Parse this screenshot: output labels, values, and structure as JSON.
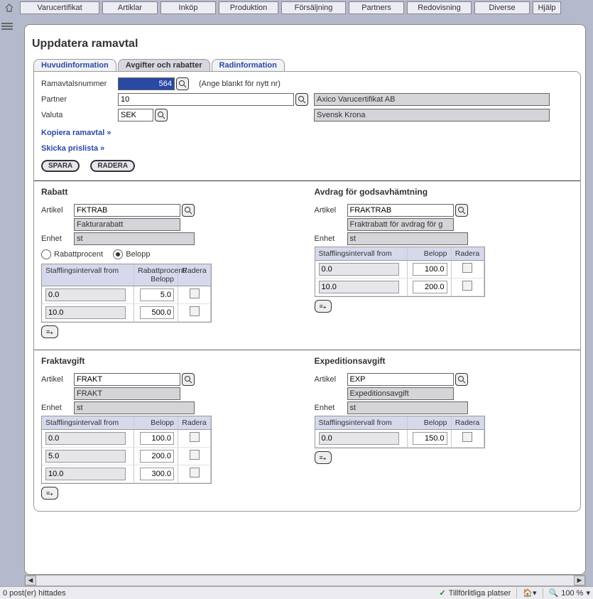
{
  "menu": [
    "Varucertifikat",
    "Artiklar",
    "Inköp",
    "Produktion",
    "Försäljning",
    "Partners",
    "Redovisning",
    "Diverse",
    "Hjälp"
  ],
  "page_title": "Uppdatera ramavtal",
  "tabs": [
    "Huvudinformation",
    "Avgifter och rabatter",
    "Radinformation"
  ],
  "active_tab": 1,
  "form": {
    "ramavtalsnummer_label": "Ramavtalsnummer",
    "ramavtalsnummer_value": "564",
    "ramavtals_hint": "(Ange blankt för nytt nr)",
    "partner_label": "Partner",
    "partner_value": "10",
    "partner_name": "Axico Varucertifikat AB",
    "valuta_label": "Valuta",
    "valuta_value": "SEK",
    "valuta_name": "Svensk Krona",
    "link_copy": "Kopiera ramavtal »",
    "link_pricelist": "Skicka prislista »",
    "btn_save": "SPARA",
    "btn_delete": "RADERA"
  },
  "headers": {
    "from": "Stafflingsintervall from",
    "rabatt_val": "Rabattprocent/\nBelopp",
    "belopp": "Belopp",
    "radera": "Radera",
    "artikel": "Artikel",
    "enhet": "Enhet"
  },
  "radio": {
    "rabattprocent": "Rabattprocent",
    "belopp": "Belopp",
    "selected": "belopp"
  },
  "rabatt": {
    "title": "Rabatt",
    "artikel_code": "FKTRAB",
    "artikel_name": "Fakturarabatt",
    "enhet": "st",
    "rows": [
      {
        "from": "0.0",
        "val": "5.0"
      },
      {
        "from": "10.0",
        "val": "500.0"
      }
    ]
  },
  "avdrag": {
    "title": "Avdrag för godsavhämtning",
    "artikel_code": "FRAKTRAB",
    "artikel_name": "Fraktrabatt för avdrag för g",
    "enhet": "st",
    "rows": [
      {
        "from": "0.0",
        "val": "100.0"
      },
      {
        "from": "10.0",
        "val": "200.0"
      }
    ]
  },
  "frakt": {
    "title": "Fraktavgift",
    "artikel_code": "FRAKT",
    "artikel_name": "FRAKT",
    "enhet": "st",
    "rows": [
      {
        "from": "0.0",
        "val": "100.0"
      },
      {
        "from": "5.0",
        "val": "200.0"
      },
      {
        "from": "10.0",
        "val": "300.0"
      }
    ]
  },
  "exp": {
    "title": "Expeditionsavgift",
    "artikel_code": "EXP",
    "artikel_name": "Expeditionsavgift",
    "enhet": "st",
    "rows": [
      {
        "from": "0.0",
        "val": "150.0"
      }
    ]
  },
  "status": {
    "posts": "0 post(er) hittades",
    "trust": "Tillförlitliga platser",
    "zoom": "100 %"
  }
}
